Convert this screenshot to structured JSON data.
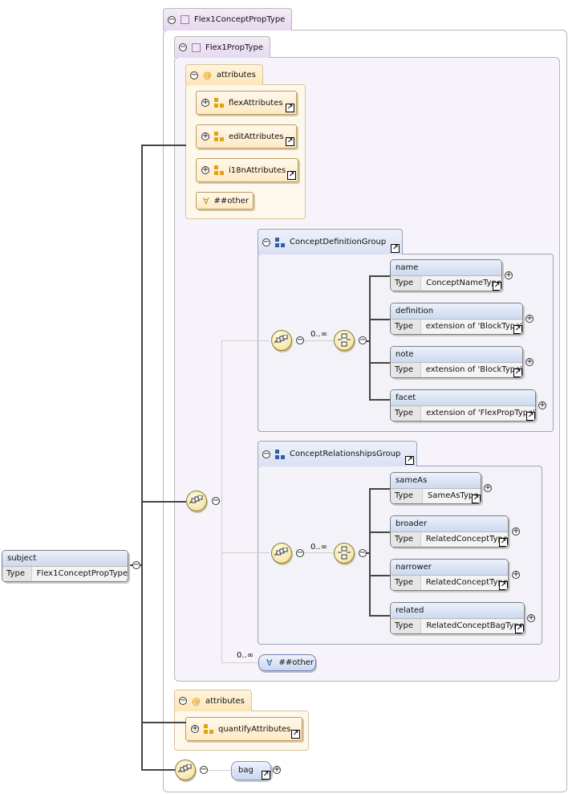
{
  "root_element": {
    "name": "subject",
    "type_label": "Type",
    "type_value": "Flex1ConceptPropType"
  },
  "outer_type": {
    "label": "Flex1ConceptPropType"
  },
  "inner_type": {
    "label": "Flex1PropType"
  },
  "attributes_top": {
    "label": "attributes",
    "refs": [
      "flexAttributes",
      "editAttributes",
      "i18nAttributes"
    ],
    "any_label": "##other"
  },
  "concept_definition_group": {
    "label": "ConceptDefinitionGroup",
    "multiplicity": "0..∞",
    "elements": [
      {
        "name": "name",
        "type_label": "Type",
        "type_value": "ConceptNameType"
      },
      {
        "name": "definition",
        "type_label": "Type",
        "type_value": "extension of 'BlockType'"
      },
      {
        "name": "note",
        "type_label": "Type",
        "type_value": "extension of 'BlockType'"
      },
      {
        "name": "facet",
        "type_label": "Type",
        "type_value": "extension of 'FlexPropType'"
      }
    ]
  },
  "concept_relationships_group": {
    "label": "ConceptRelationshipsGroup",
    "multiplicity": "0..∞",
    "elements": [
      {
        "name": "sameAs",
        "type_label": "Type",
        "type_value": "SameAsType"
      },
      {
        "name": "broader",
        "type_label": "Type",
        "type_value": "RelatedConceptType"
      },
      {
        "name": "narrower",
        "type_label": "Type",
        "type_value": "RelatedConceptType"
      },
      {
        "name": "related",
        "type_label": "Type",
        "type_value": "RelatedConceptBagType"
      }
    ]
  },
  "any_other": {
    "multiplicity": "0..∞",
    "label": "##other"
  },
  "attributes_bottom": {
    "label": "attributes",
    "refs": [
      "quantifyAttributes"
    ]
  },
  "bag": {
    "label": "bag"
  },
  "colors": {
    "element_header": "#cdd9f0",
    "attribute_tab": "#fde6b6",
    "type_tab": "#e6d9ee",
    "compositor": "#f6e6a8"
  }
}
